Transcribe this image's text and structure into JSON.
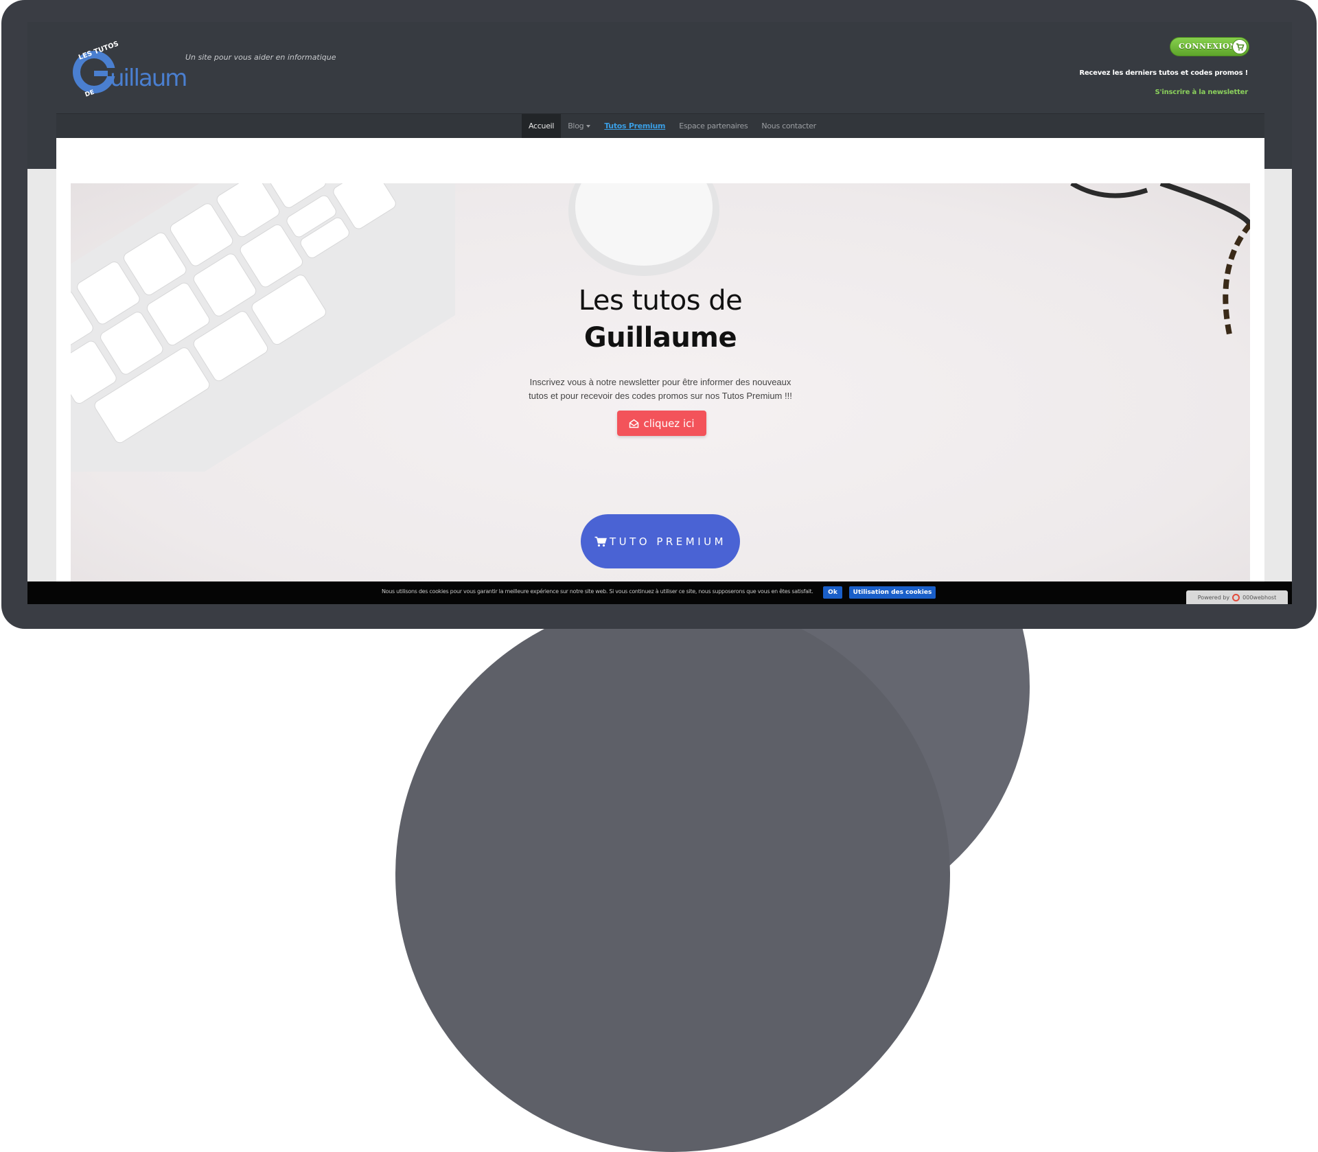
{
  "header": {
    "logo_alt": "Les Tutos de Guillaume",
    "tagline": "Un site pour vous aider en informatique",
    "connexion_label": "CONNEXION",
    "newsletter_text": "Recevez les derniers tutos et codes promos !",
    "newsletter_link": "S'inscrire à la newsletter"
  },
  "nav": {
    "items": [
      {
        "label": "Accueil"
      },
      {
        "label": "Blog"
      },
      {
        "label": "Tutos Premium"
      },
      {
        "label": "Espace partenaires"
      },
      {
        "label": "Nous contacter"
      }
    ]
  },
  "hero": {
    "title_line1": "Les tutos de",
    "title_line2": "Guillaume",
    "text": "Inscrivez vous à notre newsletter pour être informer des nouveaux tutos et pour recevoir des codes promos sur nos Tutos Premium !!!",
    "cta_label": "cliquez ici",
    "premium_label": "TUTO PREMIUM"
  },
  "cookie": {
    "text": "Nous utilisons des cookies pour vous garantir la meilleure expérience sur notre site web. Si vous continuez à utiliser ce site, nous supposerons que vous en êtes satisfait.",
    "ok_label": "Ok",
    "cookies_label": "Utilisation des cookies"
  },
  "footer": {
    "powered_by": "Powered by",
    "host_name": "000webhost"
  },
  "colors": {
    "header_bg": "#373b41",
    "accent_green": "#6cb938",
    "cta_red": "#f3535a",
    "premium_blue": "#4a63d4",
    "link_blue": "#3a9ee4"
  }
}
